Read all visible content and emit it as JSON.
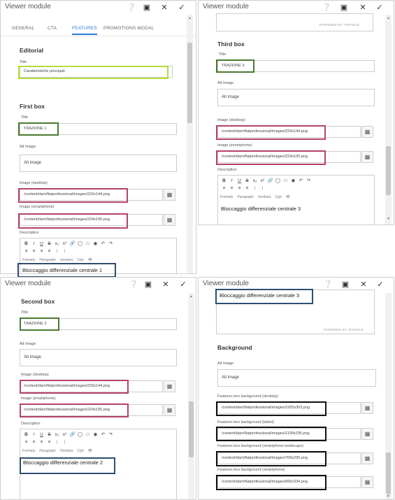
{
  "window_title": "Viewer module",
  "tabs": [
    "GENERAL",
    "CTA",
    "FEATURES",
    "PROMOTIONS MODAL"
  ],
  "labels": {
    "title": "Title",
    "alt_image": "Alt Image",
    "image_desktop": "Image (desktop)",
    "image_smartphone": "Image (smartphone)",
    "description": "Description"
  },
  "sections": {
    "editorial": "Editorial",
    "first_box": "First box",
    "second_box": "Second box",
    "third_box": "Third box",
    "background": "Background"
  },
  "values": {
    "editorial_title": "Caratteristiche principali",
    "alt_placeholder": "Alt image",
    "box1_title": "TRAZIONE 1",
    "box2_title": "TRAZIONE 2",
    "box3_title": "TRAZIONE 3",
    "img_desktop": "/content/dam/fiatprofessional/images/233x144.png",
    "img_smartphone": "/content/dam/fiatprofessional/images/224x105.png",
    "desc1": "Bloccaggio differenziale centrale 1",
    "desc2": "Bloccaggio differenziale centrale 2",
    "desc3": "Bloccaggio differenziale centrale 3"
  },
  "rte": {
    "formats": "Formats",
    "paragraph": "Paragraph",
    "font": "Verdana",
    "size": "11pt",
    "powered": "POWERED BY TINYMCE"
  },
  "background": {
    "label_desktop": "Features box background (desktop)",
    "label_tablet": "Features box background (tablet)",
    "label_landscape": "Features box background (smartphone landscape)",
    "label_smartphone": "Features box background (smartphone)",
    "val_desktop": "/content/dam/fiatprofessional/images/1920x303.png",
    "val_tablet": "/content/dam/fiatprofessional/images/1199x295.png",
    "val_landscape": "/content/dam/fiatprofessional/images/768x295.png",
    "val_smartphone": "/content/dam/fiatprofessional/images/666x334.png"
  },
  "icons": [
    "help-icon",
    "fullscreen-icon",
    "close-icon",
    "check-icon",
    "browse-icon"
  ],
  "highlight_colors": {
    "lime": "#b5db3a",
    "green": "#4a7a30",
    "pink": "#b5426c",
    "navy": "#2f4d70",
    "black": "#111111"
  }
}
